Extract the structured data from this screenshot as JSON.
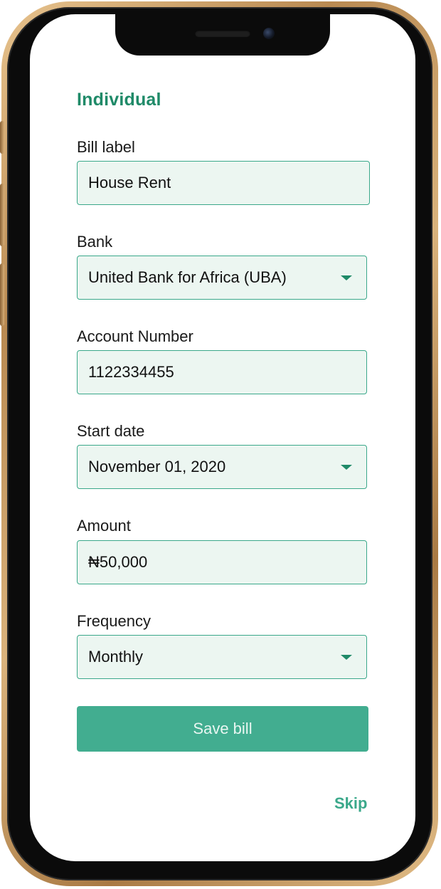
{
  "form": {
    "section_title": "Individual",
    "fields": [
      {
        "label": "Bill label",
        "value": "House Rent",
        "type": "text"
      },
      {
        "label": "Bank",
        "value": "United Bank for Africa (UBA)",
        "type": "select"
      },
      {
        "label": "Account Number",
        "value": "1122334455",
        "type": "text"
      },
      {
        "label": "Start date",
        "value": "November 01, 2020",
        "type": "select"
      },
      {
        "label": "Amount",
        "value": "₦50,000",
        "type": "text"
      },
      {
        "label": "Frequency",
        "value": "Monthly",
        "type": "select"
      }
    ],
    "save_label": "Save bill",
    "skip_label": "Skip"
  },
  "colors": {
    "accent": "#1f8a68",
    "button": "#42ad90",
    "field_bg": "#ecf6f1",
    "field_border": "#3aa88a"
  },
  "icons": {
    "dropdown": "caret-down-icon"
  }
}
